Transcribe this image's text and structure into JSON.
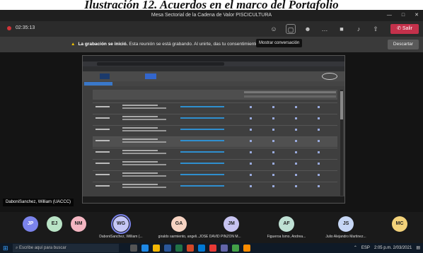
{
  "caption": "Ilustración 12. Acuerdos en el marco del Portafolio",
  "window": {
    "title": "Mesa Sectorial de la Cadena de Valor PISCICULTURA",
    "controls": [
      "—",
      "□",
      "✕"
    ]
  },
  "meeting": {
    "timer": "02:35:13",
    "tooltip": "Mostrar conversación",
    "leave_label": "Salir",
    "tools": [
      "participants-icon",
      "chat-icon",
      "reactions-icon",
      "more-icon",
      "camera-icon",
      "mic-icon",
      "share-icon"
    ]
  },
  "banner": {
    "bold": "La grabación se inició.",
    "text": " Esta reunión se está grabando. Al unirte, das tu consentimiento para que se grabe.",
    "dismiss_label": "Descartar"
  },
  "presenter_name": "DaboniSanchez, William (UACCC)",
  "participants": [
    {
      "initials": "JP",
      "name": "",
      "color": "#7b83eb"
    },
    {
      "initials": "EJ",
      "name": "",
      "color": "#b9e3c6"
    },
    {
      "initials": "NM",
      "name": "",
      "color": "#f4b6c2"
    },
    {
      "initials": "WG",
      "name": "DaboniSanchez, William (...",
      "color": "#c5c7f7",
      "selected": true
    },
    {
      "initials": "GA",
      "name": "giraldo sarmiento, angeli...",
      "color": "#f6d3c2"
    },
    {
      "initials": "",
      "name": "JOSE DAVID PINZON M...",
      "color": "#1a1a1a"
    },
    {
      "initials": "JM",
      "name": "",
      "color": "#c7c3f0"
    },
    {
      "initials": "AF",
      "name": "Figueroa Ismo, Andrea...",
      "color": "#bfe1d4"
    },
    {
      "initials": "JS",
      "name": "Julio Alejandro Martinez...",
      "color": "#c6d6f5"
    },
    {
      "initials": "MC",
      "name": "",
      "color": "#f3d27a"
    }
  ],
  "taskbar": {
    "search_placeholder": "Escribe aquí para buscar",
    "time": "2:05 p.m.",
    "date": "2/03/2021",
    "lang": "ESP"
  }
}
